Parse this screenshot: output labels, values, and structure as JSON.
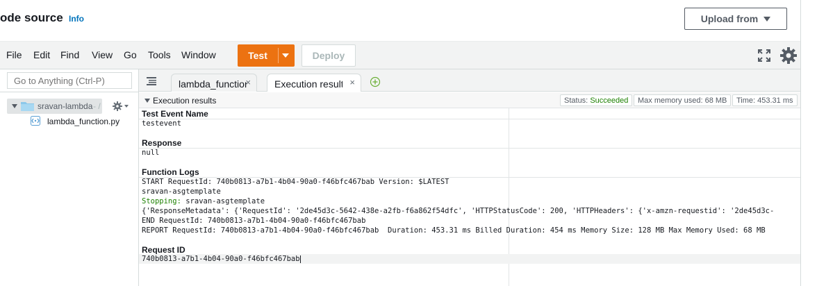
{
  "header": {
    "title": "ode source",
    "info_label": "Info",
    "upload_label": "Upload from"
  },
  "menu": {
    "items": [
      "File",
      "Edit",
      "Find",
      "View",
      "Go",
      "Tools",
      "Window"
    ],
    "test_label": "Test",
    "deploy_label": "Deploy"
  },
  "sidebar": {
    "goto_placeholder": "Go to Anything (Ctrl-P)",
    "root_folder": "sravan-lambda",
    "root_suffix": "- /",
    "file": "lambda_function.py"
  },
  "tabs": [
    {
      "label": "lambda_function",
      "close": "×"
    },
    {
      "label": "Execution results",
      "close": "×"
    }
  ],
  "results": {
    "title": "Execution results",
    "status_prefix": "Status:",
    "status_value": "Succeeded",
    "memory": "Max memory used: 68 MB",
    "time": "Time: 453.31 ms",
    "test_event_label": "Test Event Name",
    "test_event_value": "testevent",
    "response_label": "Response",
    "response_value": "null",
    "logs_label": "Function Logs",
    "logs": {
      "line1": "START RequestId: 740b0813-a7b1-4b04-90a0-f46bfc467bab Version: $LATEST",
      "line2": "sravan-asgtemplate",
      "line3_prefix": "Stopping:",
      "line3_value": " sravan-asgtemplate",
      "line4": "{'ResponseMetadata': {'RequestId': '2de45d3c-5642-438e-a2fb-f6a862f54dfc', 'HTTPStatusCode': 200, 'HTTPHeaders': {'x-amzn-requestid': '2de45d3c-",
      "line5": "END RequestId: 740b0813-a7b1-4b04-90a0-f46bfc467bab",
      "line6": "REPORT RequestId: 740b0813-a7b1-4b04-90a0-f46bfc467bab  Duration: 453.31 ms Billed Duration: 454 ms Memory Size: 128 MB Max Memory Used: 68 MB"
    },
    "request_id_label": "Request ID",
    "request_id_value": "740b0813-a7b1-4b04-90a0-f46bfc467bab"
  },
  "colors": {
    "accent": "#ec7211",
    "success": "#1d8102",
    "link": "#0073bb"
  }
}
